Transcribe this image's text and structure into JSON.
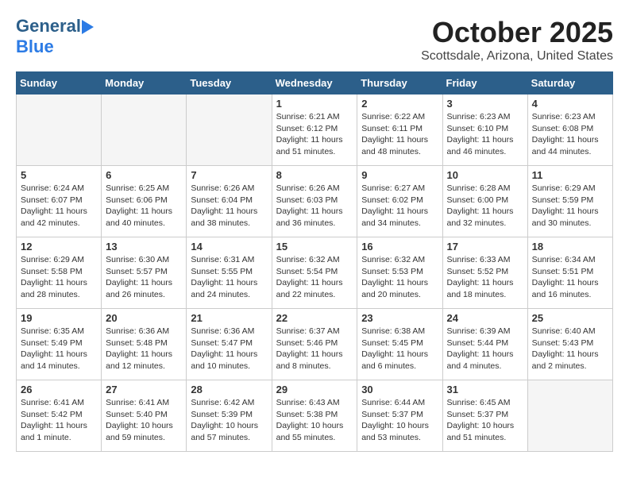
{
  "header": {
    "logo_general": "General",
    "logo_blue": "Blue",
    "title": "October 2025",
    "subtitle": "Scottsdale, Arizona, United States"
  },
  "weekdays": [
    "Sunday",
    "Monday",
    "Tuesday",
    "Wednesday",
    "Thursday",
    "Friday",
    "Saturday"
  ],
  "weeks": [
    [
      {
        "day": "",
        "content": ""
      },
      {
        "day": "",
        "content": ""
      },
      {
        "day": "",
        "content": ""
      },
      {
        "day": "1",
        "content": "Sunrise: 6:21 AM\nSunset: 6:12 PM\nDaylight: 11 hours\nand 51 minutes."
      },
      {
        "day": "2",
        "content": "Sunrise: 6:22 AM\nSunset: 6:11 PM\nDaylight: 11 hours\nand 48 minutes."
      },
      {
        "day": "3",
        "content": "Sunrise: 6:23 AM\nSunset: 6:10 PM\nDaylight: 11 hours\nand 46 minutes."
      },
      {
        "day": "4",
        "content": "Sunrise: 6:23 AM\nSunset: 6:08 PM\nDaylight: 11 hours\nand 44 minutes."
      }
    ],
    [
      {
        "day": "5",
        "content": "Sunrise: 6:24 AM\nSunset: 6:07 PM\nDaylight: 11 hours\nand 42 minutes."
      },
      {
        "day": "6",
        "content": "Sunrise: 6:25 AM\nSunset: 6:06 PM\nDaylight: 11 hours\nand 40 minutes."
      },
      {
        "day": "7",
        "content": "Sunrise: 6:26 AM\nSunset: 6:04 PM\nDaylight: 11 hours\nand 38 minutes."
      },
      {
        "day": "8",
        "content": "Sunrise: 6:26 AM\nSunset: 6:03 PM\nDaylight: 11 hours\nand 36 minutes."
      },
      {
        "day": "9",
        "content": "Sunrise: 6:27 AM\nSunset: 6:02 PM\nDaylight: 11 hours\nand 34 minutes."
      },
      {
        "day": "10",
        "content": "Sunrise: 6:28 AM\nSunset: 6:00 PM\nDaylight: 11 hours\nand 32 minutes."
      },
      {
        "day": "11",
        "content": "Sunrise: 6:29 AM\nSunset: 5:59 PM\nDaylight: 11 hours\nand 30 minutes."
      }
    ],
    [
      {
        "day": "12",
        "content": "Sunrise: 6:29 AM\nSunset: 5:58 PM\nDaylight: 11 hours\nand 28 minutes."
      },
      {
        "day": "13",
        "content": "Sunrise: 6:30 AM\nSunset: 5:57 PM\nDaylight: 11 hours\nand 26 minutes."
      },
      {
        "day": "14",
        "content": "Sunrise: 6:31 AM\nSunset: 5:55 PM\nDaylight: 11 hours\nand 24 minutes."
      },
      {
        "day": "15",
        "content": "Sunrise: 6:32 AM\nSunset: 5:54 PM\nDaylight: 11 hours\nand 22 minutes."
      },
      {
        "day": "16",
        "content": "Sunrise: 6:32 AM\nSunset: 5:53 PM\nDaylight: 11 hours\nand 20 minutes."
      },
      {
        "day": "17",
        "content": "Sunrise: 6:33 AM\nSunset: 5:52 PM\nDaylight: 11 hours\nand 18 minutes."
      },
      {
        "day": "18",
        "content": "Sunrise: 6:34 AM\nSunset: 5:51 PM\nDaylight: 11 hours\nand 16 minutes."
      }
    ],
    [
      {
        "day": "19",
        "content": "Sunrise: 6:35 AM\nSunset: 5:49 PM\nDaylight: 11 hours\nand 14 minutes."
      },
      {
        "day": "20",
        "content": "Sunrise: 6:36 AM\nSunset: 5:48 PM\nDaylight: 11 hours\nand 12 minutes."
      },
      {
        "day": "21",
        "content": "Sunrise: 6:36 AM\nSunset: 5:47 PM\nDaylight: 11 hours\nand 10 minutes."
      },
      {
        "day": "22",
        "content": "Sunrise: 6:37 AM\nSunset: 5:46 PM\nDaylight: 11 hours\nand 8 minutes."
      },
      {
        "day": "23",
        "content": "Sunrise: 6:38 AM\nSunset: 5:45 PM\nDaylight: 11 hours\nand 6 minutes."
      },
      {
        "day": "24",
        "content": "Sunrise: 6:39 AM\nSunset: 5:44 PM\nDaylight: 11 hours\nand 4 minutes."
      },
      {
        "day": "25",
        "content": "Sunrise: 6:40 AM\nSunset: 5:43 PM\nDaylight: 11 hours\nand 2 minutes."
      }
    ],
    [
      {
        "day": "26",
        "content": "Sunrise: 6:41 AM\nSunset: 5:42 PM\nDaylight: 11 hours\nand 1 minute."
      },
      {
        "day": "27",
        "content": "Sunrise: 6:41 AM\nSunset: 5:40 PM\nDaylight: 10 hours\nand 59 minutes."
      },
      {
        "day": "28",
        "content": "Sunrise: 6:42 AM\nSunset: 5:39 PM\nDaylight: 10 hours\nand 57 minutes."
      },
      {
        "day": "29",
        "content": "Sunrise: 6:43 AM\nSunset: 5:38 PM\nDaylight: 10 hours\nand 55 minutes."
      },
      {
        "day": "30",
        "content": "Sunrise: 6:44 AM\nSunset: 5:37 PM\nDaylight: 10 hours\nand 53 minutes."
      },
      {
        "day": "31",
        "content": "Sunrise: 6:45 AM\nSunset: 5:37 PM\nDaylight: 10 hours\nand 51 minutes."
      },
      {
        "day": "",
        "content": ""
      }
    ]
  ]
}
